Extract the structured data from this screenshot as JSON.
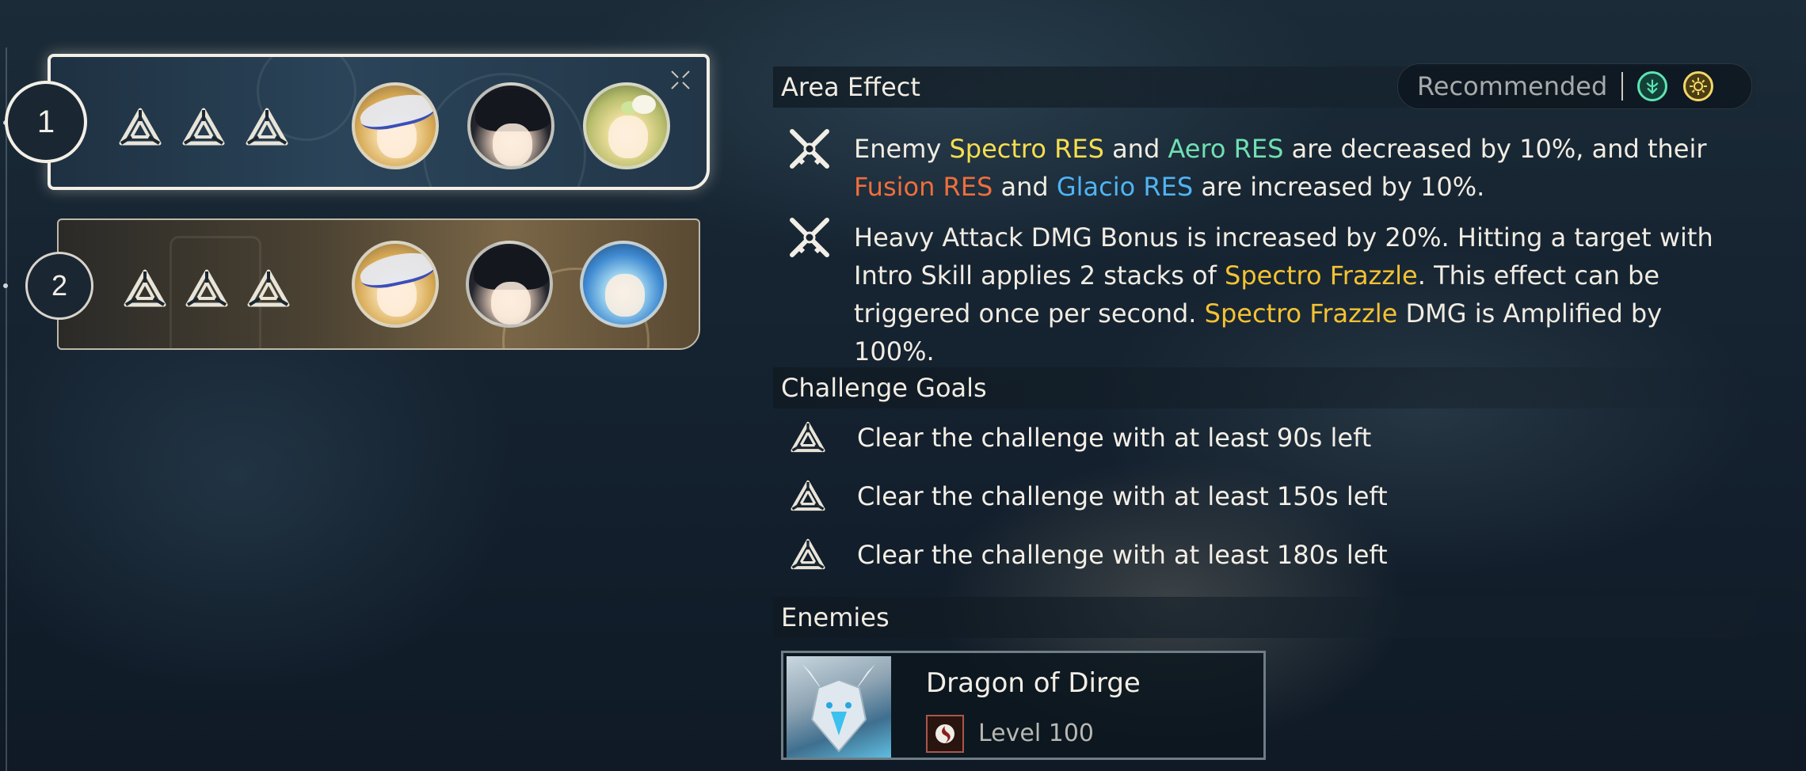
{
  "stages": [
    {
      "number": "1",
      "selected": true
    },
    {
      "number": "2",
      "selected": false
    }
  ],
  "area_effect": {
    "title": "Area Effect",
    "recommended_label": "Recommended",
    "recommended_elements": [
      "aero-icon",
      "spectro-icon"
    ],
    "effect1": {
      "t1": "Enemy ",
      "spectro_res": "Spectro RES",
      "t2": " and ",
      "aero_res": "Aero RES",
      "t3": " are decreased by 10%, and their",
      "fusion_res": "Fusion RES",
      "t4": " and ",
      "glacio_res": "Glacio RES",
      "t5": " are increased by 10%."
    },
    "effect2": {
      "t1": "Heavy Attack DMG Bonus is increased by 20%. Hitting a target with Intro Skill applies 2 stacks of ",
      "frazzle1": "Spectro Frazzle",
      "t2": ". This effect can be triggered once per second. ",
      "frazzle2": "Spectro Frazzle",
      "t3": " DMG is Amplified by 100%."
    }
  },
  "challenge_goals": {
    "title": "Challenge Goals",
    "goals": [
      "Clear the challenge with at least 90s left",
      "Clear the challenge with at least 150s left",
      "Clear the challenge with at least 180s left"
    ]
  },
  "enemies": {
    "title": "Enemies",
    "list": [
      {
        "name": "Dragon of Dirge",
        "level": "Level 100",
        "element_icon": "havoc-icon"
      }
    ]
  },
  "colors": {
    "spectro": "#f6df4e",
    "aero": "#6fe0b2",
    "fusion": "#ef6e3c",
    "glacio": "#4fb4f4",
    "frazzle": "#f5c231"
  }
}
